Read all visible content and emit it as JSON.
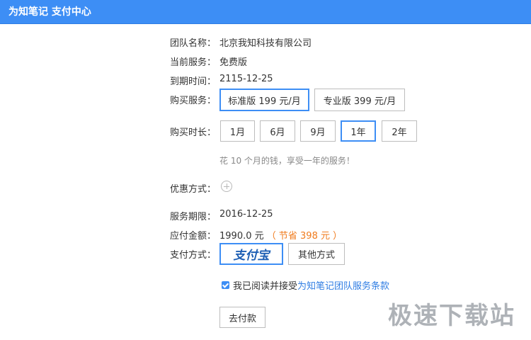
{
  "window": {
    "title": "为知笔记 支付中心"
  },
  "team": {
    "label": "团队名称：",
    "value": "北京我知科技有限公司"
  },
  "current_service": {
    "label": "当前服务：",
    "value": "免费版"
  },
  "expiry": {
    "label": "到期时间：",
    "value": "2115-12-25"
  },
  "purchase_service": {
    "label": "购买服务：",
    "options": [
      {
        "label": "标准版 199 元/月",
        "selected": true
      },
      {
        "label": "专业版 399 元/月",
        "selected": false
      }
    ]
  },
  "duration": {
    "label": "购买时长：",
    "options": [
      {
        "label": "1月",
        "selected": false
      },
      {
        "label": "6月",
        "selected": false
      },
      {
        "label": "9月",
        "selected": false
      },
      {
        "label": "1年",
        "selected": true
      },
      {
        "label": "2年",
        "selected": false
      }
    ],
    "hint": "花 10 个月的钱，享受一年的服务！"
  },
  "discount": {
    "label": "优惠方式："
  },
  "service_period": {
    "label": "服务期限：",
    "value": "2016-12-25"
  },
  "amount": {
    "label": "应付金额：",
    "value": "1990.0 元",
    "savings": "（ 节省 398 元 ）"
  },
  "payment": {
    "label": "支付方式：",
    "alipay_text": "支付宝",
    "other_label": "其他方式"
  },
  "agreement": {
    "checked": true,
    "text": "我已阅读并接受",
    "link": "为知笔记团队服务条款"
  },
  "submit_label": "去付款",
  "watermark": "极速下载站",
  "colors": {
    "accent": "#3d8ef5",
    "savings": "#f07b1d",
    "link": "#2f7de3"
  }
}
